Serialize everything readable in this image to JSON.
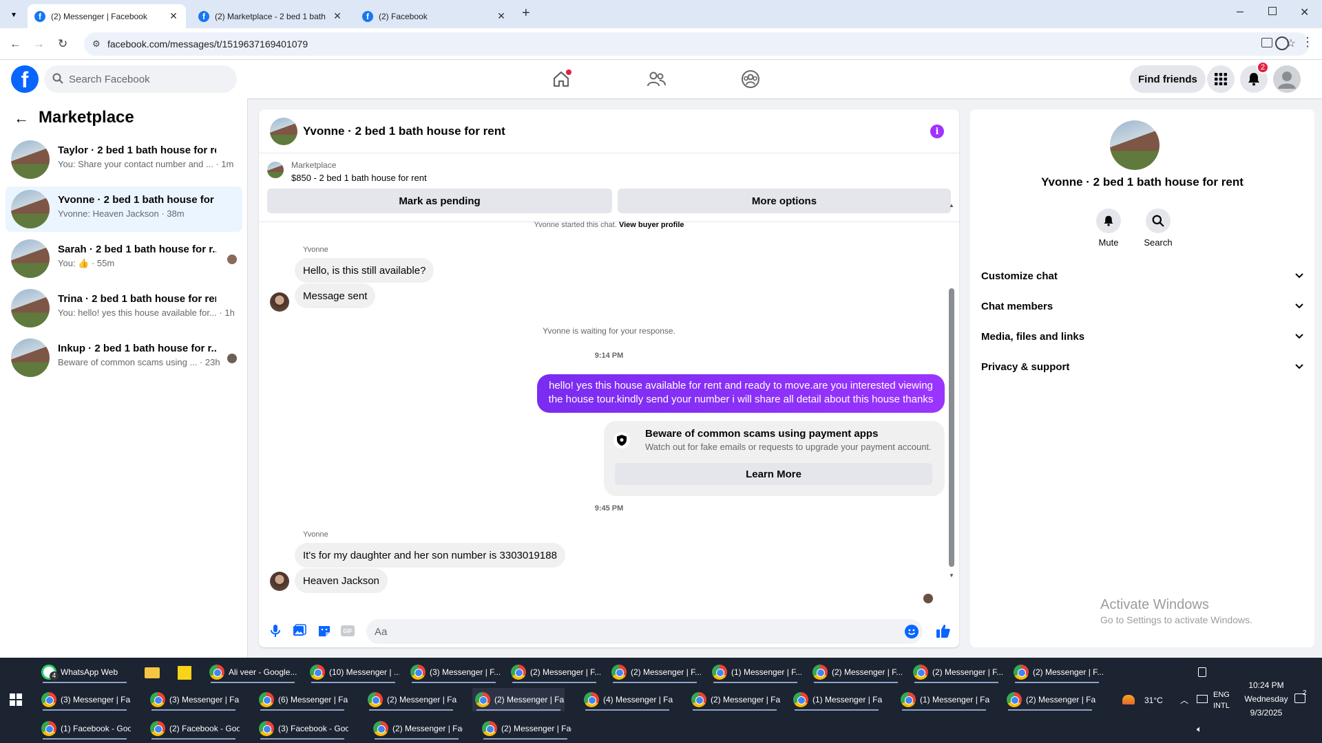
{
  "browser": {
    "tabs": [
      {
        "title": "(2) Messenger | Facebook",
        "active": true
      },
      {
        "title": "(2) Marketplace - 2 bed 1 bath",
        "active": false
      },
      {
        "title": "(2) Facebook",
        "active": false
      }
    ],
    "url": "facebook.com/messages/t/1519637169401079"
  },
  "fb_header": {
    "search_placeholder": "Search Facebook",
    "find_friends": "Find friends",
    "notifications_count": "2"
  },
  "left_panel": {
    "title": "Marketplace",
    "conversations": [
      {
        "name": "Taylor · 2 bed 1 bath house for rent",
        "preview": "You: Share your contact number and ... · 1m",
        "selected": false
      },
      {
        "name": "Yvonne · 2 bed 1 bath house for rent",
        "preview": "Yvonne: Heaven Jackson · 38m",
        "selected": true
      },
      {
        "name": "Sarah · 2 bed 1 bath house for r...",
        "preview": "You: 👍 · 55m",
        "selected": false
      },
      {
        "name": "Trina · 2 bed 1 bath house for rent",
        "preview": "You: hello! yes this house available for... · 1h",
        "selected": false
      },
      {
        "name": "Inkup · 2 bed 1 bath house for r...",
        "preview": "Beware of common scams using ... · 23h",
        "selected": false
      }
    ]
  },
  "chat": {
    "title": "Yvonne · 2 bed 1 bath house for rent",
    "listing_label": "Marketplace",
    "listing_price": "$850 - 2 bed 1 bath house for rent",
    "mark_pending": "Mark as pending",
    "more_options": "More options",
    "started_text": "Yvonne started this chat.",
    "view_profile": "View buyer profile",
    "sender1": "Yvonne",
    "msg1": "Hello, is this still available?",
    "msg2": "Message sent",
    "waiting": "Yvonne is waiting for your response.",
    "time1": "9:14 PM",
    "my_msg": "hello! yes this house available for rent and ready to move.are you interested viewing the house tour.kindly send your number i will share all detail about this house thanks",
    "scam_title": "Beware of common scams using payment apps",
    "scam_desc": "Watch out for fake emails or requests to upgrade your payment account.",
    "learn_more": "Learn More",
    "time2": "9:45 PM",
    "sender2": "Yvonne",
    "msg3": "It's for my daughter and her son number is 3303019188",
    "msg4": "Heaven Jackson",
    "input_placeholder": "Aa"
  },
  "right_panel": {
    "name": "Yvonne · 2 bed 1 bath house for rent",
    "mute": "Mute",
    "search": "Search",
    "sections": [
      "Customize chat",
      "Chat members",
      "Media, files and links",
      "Privacy & support"
    ]
  },
  "watermark": {
    "line1": "Activate Windows",
    "line2": "Go to Settings to activate Windows."
  },
  "taskbar": {
    "row1": [
      "WhatsApp Web",
      "Ali veer - Google...",
      "(10) Messenger | ...",
      "(3) Messenger | F...",
      "(2) Messenger | F...",
      "(2) Messenger | F...",
      "(1) Messenger | F...",
      "(2) Messenger | F...",
      "(2) Messenger | F...",
      "(2) Messenger | F..."
    ],
    "row2": [
      "(3) Messenger | Fa...",
      "(3) Messenger | Fa...",
      "(6) Messenger | Fa...",
      "(2) Messenger | Fa...",
      "(2) Messenger | Fa...",
      "(4) Messenger | Fa...",
      "(2) Messenger | Fa...",
      "(1) Messenger | Fa...",
      "(1) Messenger | Fa...",
      "(2) Messenger | Fa..."
    ],
    "row3": [
      "(1) Facebook - Goo...",
      "(2) Facebook - Goo...",
      "(3) Facebook - Goo...",
      "(2) Messenger | Fac...",
      "(2) Messenger | Fac..."
    ],
    "whatsapp_badge": "4",
    "weather": "31°C",
    "lang1": "ENG",
    "lang2": "INTL",
    "time": "10:24 PM",
    "day": "Wednesday",
    "date": "9/3/2025",
    "notif": "2"
  }
}
